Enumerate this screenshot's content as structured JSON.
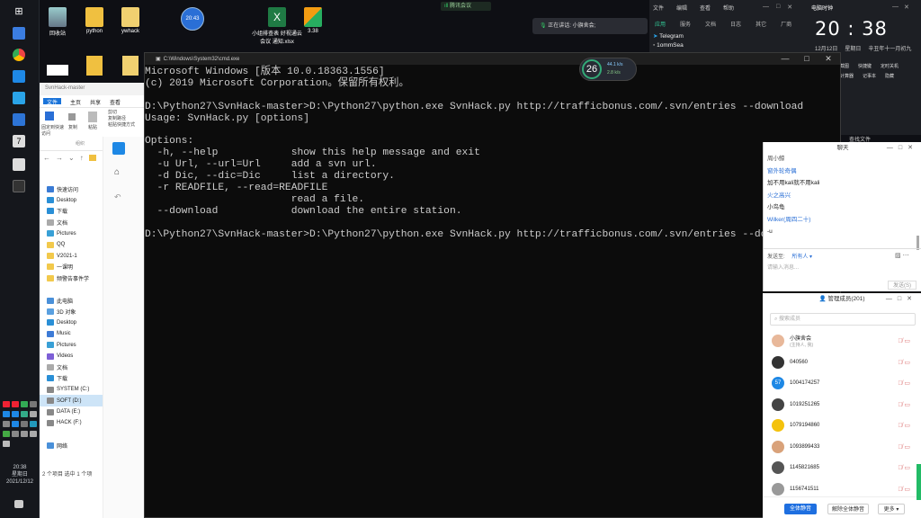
{
  "taskbar": {
    "time": "20:38",
    "weekday": "星期日",
    "date": "2021/12/12"
  },
  "desktop": {
    "icons": [
      {
        "label": "回收站"
      },
      {
        "label": "python"
      },
      {
        "label": "ywhack"
      },
      {
        "label": "小组排查表 好视通云会议 通知.xlsx"
      },
      {
        "label": "3.38"
      }
    ],
    "circle_clock": "20:43"
  },
  "meeting_bar": {
    "label": "腾讯会议"
  },
  "speaking": {
    "label": "正在讲话: 小旗舍会;"
  },
  "top_right": {
    "menu": [
      "文件",
      "编辑",
      "查看",
      "帮助"
    ],
    "tabs": [
      "应用",
      "服务",
      "文档",
      "日志",
      "其它",
      "厂商"
    ],
    "apps": [
      "Telegram",
      "1ommSea"
    ],
    "clock_label": "电脑时钟",
    "time": "20 : 38",
    "date": "12月12日",
    "weekday": "星期日",
    "lunar": "辛丑年十一月初九",
    "tools": [
      "截图",
      "设置",
      "计算器",
      "记事本",
      "隐藏",
      "快捷键",
      "定时关机"
    ],
    "files_label": "查找文件"
  },
  "perf": {
    "percent": "26",
    "up": "44.1 k/s",
    "down": "2.8 k/s"
  },
  "explorer": {
    "title": "SvnHack-master",
    "ribbon": [
      "文件",
      "主页",
      "共享",
      "查看"
    ],
    "tools": [
      "固定到快速访问",
      "复制",
      "粘贴",
      "剪切",
      "复制路径",
      "粘贴快捷方式",
      "组织"
    ],
    "nav": [
      {
        "label": "快速访问",
        "color": "#3a7bd5"
      },
      {
        "label": "Desktop",
        "color": "#2a8fd6"
      },
      {
        "label": "下载",
        "color": "#2a8fd6"
      },
      {
        "label": "文档",
        "color": "#aaa"
      },
      {
        "label": "Pictures",
        "color": "#39a0d6"
      },
      {
        "label": "QQ",
        "color": "#f2c94c"
      },
      {
        "label": "V2021-1",
        "color": "#f2c94c"
      },
      {
        "label": "一课明",
        "color": "#f2c94c"
      },
      {
        "label": "频警告事件学",
        "color": "#f2c94c"
      },
      {
        "label": "",
        "color": "#fff"
      },
      {
        "label": "此电脑",
        "color": "#4a90d9"
      },
      {
        "label": "3D 对象",
        "color": "#5aa0e0"
      },
      {
        "label": "Desktop",
        "color": "#2a8fd6"
      },
      {
        "label": "Music",
        "color": "#3d7bd6"
      },
      {
        "label": "Pictures",
        "color": "#39a0d6"
      },
      {
        "label": "Videos",
        "color": "#7d5fd6"
      },
      {
        "label": "文档",
        "color": "#aaa"
      },
      {
        "label": "下载",
        "color": "#2a8fd6"
      },
      {
        "label": "SYSTEM (C:)",
        "color": "#888"
      },
      {
        "label": "SOFT (D:)",
        "color": "#888",
        "selected": true
      },
      {
        "label": "DATA (E:)",
        "color": "#888"
      },
      {
        "label": "HACK (F:)",
        "color": "#888"
      },
      {
        "label": "",
        "color": "#fff"
      },
      {
        "label": "网络",
        "color": "#4a90d9"
      }
    ],
    "status": "2 个项目    选中 1 个项"
  },
  "cmd": {
    "title": "C:\\Windows\\System32\\cmd.exe",
    "lines": [
      "Microsoft Windows [版本 10.0.18363.1556]",
      "(c) 2019 Microsoft Corporation。保留所有权利。",
      "",
      "D:\\Python27\\SvnHack-master>D:\\Python27\\python.exe SvnHack.py http://trafficbonus.com/.svn/entries --download",
      "Usage: SvnHack.py [options]",
      "",
      "Options:",
      "  -h, --help            show this help message and exit",
      "  -u Url, --url=Url     add a svn url.",
      "  -d Dic, --dic=Dic     list a directory.",
      "  -r READFILE, --read=READFILE",
      "                        read a file.",
      "  --download            download the entire station.",
      "",
      "D:\\Python27\\SvnHack-master>D:\\Python27\\python.exe SvnHack.py http://trafficbonus.com/.svn/entries --download"
    ]
  },
  "chat": {
    "title": "聊天",
    "messages": [
      {
        "text": "周小鲸",
        "color": "#555"
      },
      {
        "text": "窗外轮奇偶",
        "color": "#2a6fd6"
      },
      {
        "text": "加不用kali就不用kali",
        "color": "#222"
      },
      {
        "text": "火之高兴",
        "color": "#2a6fd6"
      },
      {
        "text": "小鸟龟",
        "color": "#222"
      },
      {
        "text": "Wilker(周四二十)",
        "color": "#2a6fd6"
      },
      {
        "text": "-u",
        "color": "#222"
      }
    ],
    "send_to_label": "发送至:",
    "send_to_value": "所有人",
    "input_placeholder": "请输入消息...",
    "send_button": "发送(S)"
  },
  "members": {
    "title": "管理成员(201)",
    "search_placeholder": "搜索成员",
    "list": [
      {
        "name": "小旗舍会",
        "sub": "(主持人, 我)",
        "color": "#e8b89a"
      },
      {
        "name": "040560",
        "sub": "",
        "color": "#333"
      },
      {
        "name": "1004174257",
        "sub": "",
        "color": "#1e88e5"
      },
      {
        "name": "1019251265",
        "sub": "",
        "color": "#444"
      },
      {
        "name": "1079194860",
        "sub": "",
        "color": "#f4c20d"
      },
      {
        "name": "1093899433",
        "sub": "",
        "color": "#d9a27a"
      },
      {
        "name": "1145821685",
        "sub": "",
        "color": "#555"
      },
      {
        "name": "1156741511",
        "sub": "",
        "color": "#999"
      }
    ],
    "avatar_57": "57",
    "buttons": [
      "全体静音",
      "解除全体静音",
      "更多"
    ]
  }
}
